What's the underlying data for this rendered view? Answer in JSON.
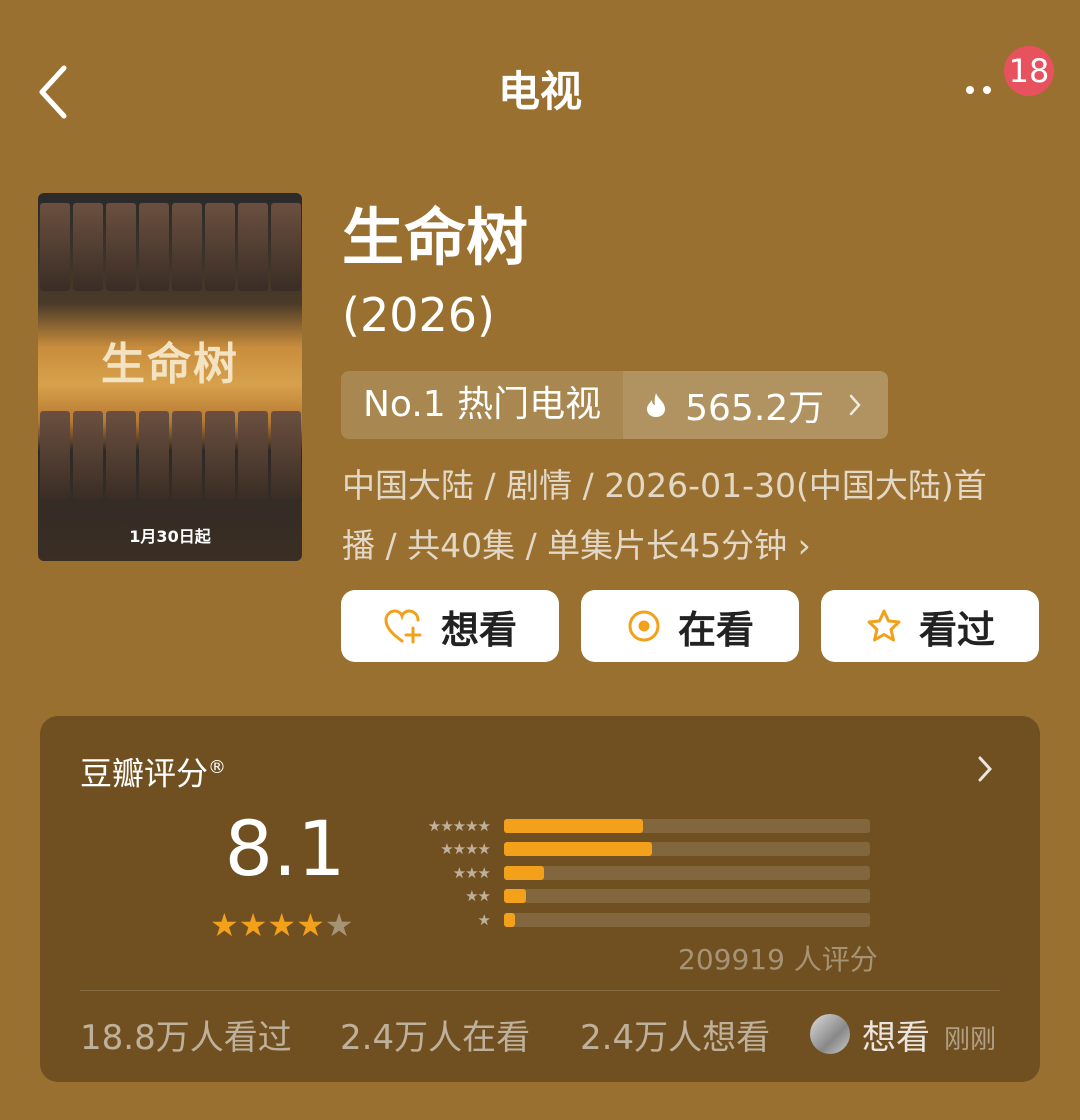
{
  "header": {
    "title": "电视",
    "badge_count": "18"
  },
  "subject": {
    "title": "生命树",
    "year": "(2026)",
    "rank_label": "No.1 热门电视",
    "hot_value": "565.2万",
    "meta_line1": "中国大陆 / 剧情 / 2026-01-30(中国大陆)首",
    "meta_line2": "播 / 共40集 / 单集片长45分钟 ›",
    "poster_title": "生命树",
    "poster_date": "1月30日起"
  },
  "actions": {
    "want": "想看",
    "watching": "在看",
    "watched": "看过"
  },
  "rating": {
    "label": "豆瓣评分",
    "mark": "®",
    "score": "8.1",
    "stars": "★★★★",
    "stars_off": "★",
    "star_rows": [
      "★★★★★",
      "★★★★",
      "★★★",
      "★★",
      "★"
    ],
    "distribution": [
      0.38,
      0.405,
      0.11,
      0.06,
      0.03
    ],
    "votes": "209919 人评分",
    "watched": "18.8万人看过",
    "watching": "2.4万人在看",
    "wants": "2.4万人想看",
    "friend_status": "想看",
    "friend_time": "刚刚"
  },
  "colors": {
    "background": "#99702f",
    "accent": "#f3a01b",
    "badge": "#e8525f"
  }
}
